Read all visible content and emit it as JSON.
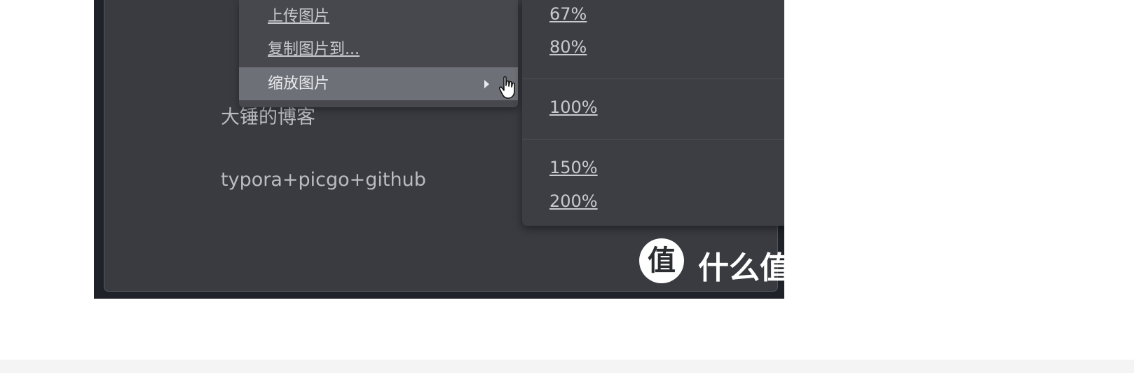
{
  "context_menu": {
    "items": [
      {
        "label": "上传图片"
      },
      {
        "label": "复制图片到..."
      },
      {
        "label": "缩放图片"
      }
    ]
  },
  "zoom_submenu": {
    "items": [
      "67%",
      "80%",
      "100%",
      "150%",
      "200%"
    ]
  },
  "document": {
    "line1": "大锤的博客",
    "line2": "typora+picgo+github"
  },
  "watermark": {
    "logo_char": "值",
    "text": "什么值得买"
  },
  "colors": {
    "window_bg": "#393b41",
    "menu_bg": "#46484d",
    "menu_highlight": "#6e7077",
    "submenu_bg": "#3c3e43",
    "text": "#c8cacf"
  }
}
